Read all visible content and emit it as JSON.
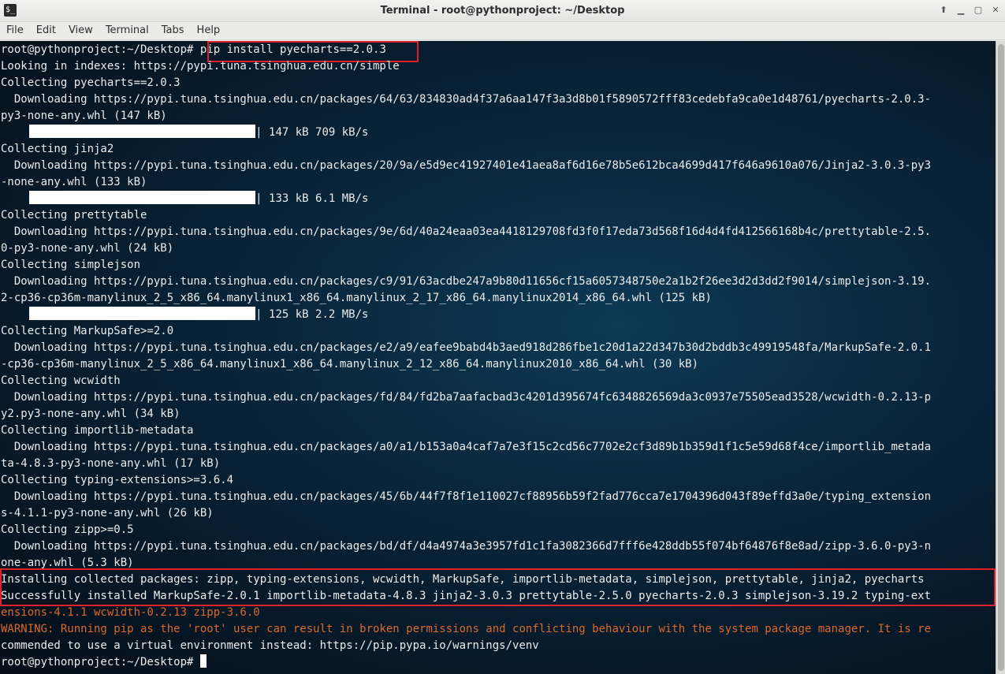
{
  "window": {
    "title": "Terminal - root@pythonproject: ~/Desktop",
    "controls": [
      "up-icon",
      "minimize-icon",
      "maximize-icon",
      "close-icon"
    ]
  },
  "menu": [
    "File",
    "Edit",
    "View",
    "Terminal",
    "Tabs",
    "Help"
  ],
  "terminal": {
    "prompt": "root@pythonproject:~/Desktop#",
    "command": "pip install pyecharts==2.0.3",
    "output": [
      "Looking in indexes: https://pypi.tuna.tsinghua.edu.cn/simple",
      "Collecting pyecharts==2.0.3",
      "  Downloading https://pypi.tuna.tsinghua.edu.cn/packages/64/63/834830ad4f37a6aa147f3a3d8b01f5890572fff83cedebfa9ca0e1d48761/pyecharts-2.0.3-",
      "py3-none-any.whl (147 kB)",
      "| 147 kB 709 kB/s",
      "Collecting jinja2",
      "  Downloading https://pypi.tuna.tsinghua.edu.cn/packages/20/9a/e5d9ec41927401e41aea8af6d16e78b5e612bca4699d417f646a9610a076/Jinja2-3.0.3-py3",
      "-none-any.whl (133 kB)",
      "| 133 kB 6.1 MB/s",
      "Collecting prettytable",
      "  Downloading https://pypi.tuna.tsinghua.edu.cn/packages/9e/6d/40a24eaa03ea4418129708fd3f0f17eda73d568f16d4d4fd412566168b4c/prettytable-2.5.",
      "0-py3-none-any.whl (24 kB)",
      "Collecting simplejson",
      "  Downloading https://pypi.tuna.tsinghua.edu.cn/packages/c9/91/63acdbe247a9b80d11656cf15a6057348750e2a1b2f26ee3d2d3dd2f9014/simplejson-3.19.",
      "2-cp36-cp36m-manylinux_2_5_x86_64.manylinux1_x86_64.manylinux_2_17_x86_64.manylinux2014_x86_64.whl (125 kB)",
      "| 125 kB 2.2 MB/s",
      "Collecting MarkupSafe>=2.0",
      "  Downloading https://pypi.tuna.tsinghua.edu.cn/packages/e2/a9/eafee9babd4b3aed918d286fbe1c20d1a22d347b30d2bddb3c49919548fa/MarkupSafe-2.0.1",
      "-cp36-cp36m-manylinux_2_5_x86_64.manylinux1_x86_64.manylinux_2_12_x86_64.manylinux2010_x86_64.whl (30 kB)",
      "Collecting wcwidth",
      "  Downloading https://pypi.tuna.tsinghua.edu.cn/packages/fd/84/fd2ba7aafacbad3c4201d395674fc6348826569da3c0937e75505ead3528/wcwidth-0.2.13-p",
      "y2.py3-none-any.whl (34 kB)",
      "Collecting importlib-metadata",
      "  Downloading https://pypi.tuna.tsinghua.edu.cn/packages/a0/a1/b153a0a4caf7a7e3f15c2cd56c7702e2cf3d89b1b359d1f1c5e59d68f4ce/importlib_metada",
      "ta-4.8.3-py3-none-any.whl (17 kB)",
      "Collecting typing-extensions>=3.6.4",
      "  Downloading https://pypi.tuna.tsinghua.edu.cn/packages/45/6b/44f7f8f1e110027cf88956b59f2fad776cca7e1704396d043f89effd3a0e/typing_extension",
      "s-4.1.1-py3-none-any.whl (26 kB)",
      "Collecting zipp>=0.5",
      "  Downloading https://pypi.tuna.tsinghua.edu.cn/packages/bd/df/d4a4974a3e3957fd1c1fa3082366d7fff6e428ddb55f074bf64876f8e8ad/zipp-3.6.0-py3-n",
      "one-any.whl (5.3 kB)",
      "Installing collected packages: zipp, typing-extensions, wcwidth, MarkupSafe, importlib-metadata, simplejson, prettytable, jinja2, pyecharts",
      "Successfully installed MarkupSafe-2.0.1 importlib-metadata-4.8.3 jinja2-3.0.3 prettytable-2.5.0 pyecharts-2.0.3 simplejson-3.19.2 typing-ext",
      "ensions-4.1.1 wcwidth-0.2.13 zipp-3.6.0",
      "WARNING: Running pip as the 'root' user can result in broken permissions and conflicting behaviour with the system package manager. It is re",
      "commended to use a virtual environment instead: https://pip.pypa.io/warnings/venv"
    ],
    "final_prompt": "root@pythonproject:~/Desktop#"
  },
  "colors": {
    "highlight": "#e0202a",
    "warning": "#d9692c",
    "text": "#ececec"
  }
}
